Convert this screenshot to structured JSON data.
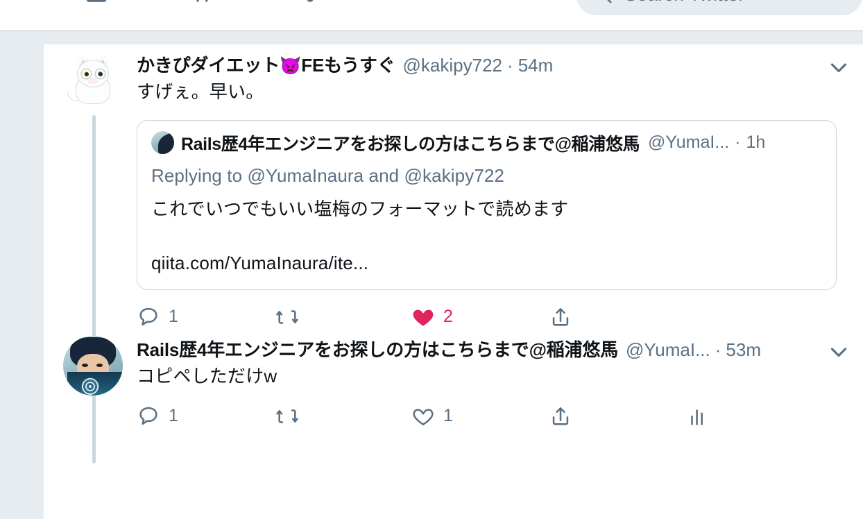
{
  "topnav": {
    "icons": [
      {
        "name": "home-icon"
      },
      {
        "name": "hashtag-explore-icon"
      },
      {
        "name": "bell-notifications-icon"
      },
      {
        "name": "mail-messages-icon"
      }
    ],
    "search": {
      "icon": "search-icon",
      "placeholder": "Search Twitter",
      "value": ""
    }
  },
  "colors": {
    "background": "#e6ecf0",
    "card": "#ffffff",
    "text": "#0f1419",
    "muted": "#5b7083",
    "border": "#ccd6dd",
    "like": "#e0245e",
    "thread_line": "#ccd6dd"
  },
  "timeline": {
    "tweets": [
      {
        "id": "tweet-1",
        "avatar": "cat-avatar",
        "display_name": "かきぴダイエット",
        "emoji": "👿",
        "display_name_suffix": "FEもうすぐ",
        "handle": "@kakipy722",
        "separator": "·",
        "time": "54m",
        "text": "すげぇ。早い。",
        "caret": "chevron-down-icon",
        "quoted": {
          "avatar": "person-book-avatar",
          "display_name": "Rails歴4年エンジニアをお探しの方はこちらまで@稲浦悠馬",
          "handle": "@YumaI...",
          "separator": "·",
          "time": "1h",
          "replying_to": "Replying to @YumaInaura and @kakipy722",
          "text": "これでいつでもいい塩梅のフォーマットで読めます",
          "link": "qiita.com/YumaInaura/ite..."
        },
        "actions": {
          "reply": {
            "icon": "reply-icon",
            "count": "1"
          },
          "retweet": {
            "icon": "retweet-icon",
            "count": ""
          },
          "like": {
            "icon": "heart-filled-icon",
            "count": "2",
            "liked": true
          },
          "share": {
            "icon": "share-icon",
            "count": ""
          }
        }
      },
      {
        "id": "tweet-2",
        "avatar": "person-book-avatar",
        "display_name": "Rails歴4年エンジニアをお探しの方はこちらまで@稲浦悠馬",
        "emoji": "",
        "display_name_suffix": "",
        "handle": "@YumaI...",
        "separator": "·",
        "time": "53m",
        "text": "コピペしただけw",
        "caret": "chevron-down-icon",
        "actions": {
          "reply": {
            "icon": "reply-icon",
            "count": "1"
          },
          "retweet": {
            "icon": "retweet-icon",
            "count": ""
          },
          "like": {
            "icon": "heart-outline-icon",
            "count": "1",
            "liked": false
          },
          "share": {
            "icon": "share-icon",
            "count": ""
          },
          "analytics": {
            "icon": "analytics-bar-icon",
            "count": ""
          }
        }
      }
    ]
  }
}
